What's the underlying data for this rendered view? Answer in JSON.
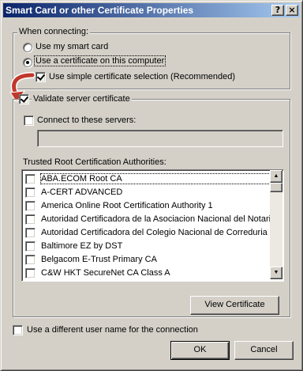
{
  "window": {
    "title": "Smart Card or other Certificate Properties",
    "help_glyph": "?",
    "close_glyph": "×"
  },
  "connecting": {
    "group_label": "When connecting:",
    "use_smart_card": "Use my smart card",
    "use_certificate": "Use a certificate on this computer",
    "simple_selection": "Use simple certificate selection (Recommended)",
    "selected": "use_certificate",
    "simple_selection_checked": true
  },
  "validate": {
    "label": "Validate server certificate",
    "checked": true,
    "connect_label": "Connect to these servers:",
    "connect_checked": false,
    "servers_value": ""
  },
  "trusted": {
    "label": "Trusted Root Certification Authorities:",
    "items": [
      "ABA.ECOM Root CA",
      "A-CERT ADVANCED",
      "America Online Root Certification Authority 1",
      "Autoridad Certificadora de la Asociacion Nacional del Notaria",
      "Autoridad Certificadora del Colegio Nacional de Correduria Pu",
      "Baltimore EZ by DST",
      "Belgacom E-Trust Primary CA",
      "C&W HKT SecureNet CA Class A"
    ],
    "scroll_up": "▲",
    "scroll_down": "▼"
  },
  "view_certificate": "View Certificate",
  "different_user": {
    "label": "Use a different user name for the connection",
    "checked": false
  },
  "ok": "OK",
  "cancel": "Cancel",
  "colors": {
    "face": "#d4d0c8",
    "title_start": "#0a246a",
    "title_end": "#a6caf0",
    "arrow": "#c0392b"
  }
}
